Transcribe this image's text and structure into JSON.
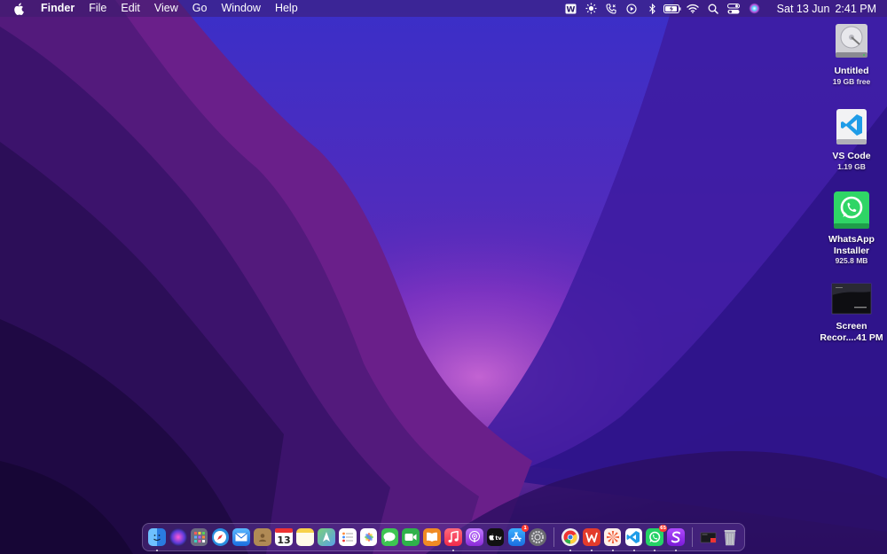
{
  "menubar": {
    "app_name": "Finder",
    "items": [
      "File",
      "Edit",
      "View",
      "Go",
      "Window",
      "Help"
    ],
    "status_icons": [
      "word-icon",
      "sun-icon",
      "phone-icon",
      "play-icon",
      "bluetooth-icon",
      "battery-icon",
      "wifi-icon",
      "search-icon",
      "control-center-icon",
      "siri-icon"
    ],
    "date": "Sat 13 Jun",
    "time": "2:41 PM"
  },
  "desktop": {
    "items": [
      {
        "name": "Untitled",
        "sub": "19 GB free",
        "icon": "hard-drive-icon"
      },
      {
        "name": "VS Code",
        "sub": "1.19 GB",
        "icon": "vscode-icon"
      },
      {
        "name": "WhatsApp",
        "name2": "Installer",
        "sub": "925.8 MB",
        "icon": "whatsapp-icon"
      },
      {
        "name": "Screen",
        "name2": "Recor....41 PM",
        "icon": "screen-recording-icon"
      }
    ]
  },
  "dock": {
    "apps": [
      {
        "name": "finder",
        "color": "#3a8ee6",
        "running": true
      },
      {
        "name": "siri",
        "color": "#4b2fa3"
      },
      {
        "name": "launchpad",
        "color": "#8a8aa0"
      },
      {
        "name": "safari",
        "color": "#2a8fe0"
      },
      {
        "name": "mail",
        "color": "#2a7fe8"
      },
      {
        "name": "contacts",
        "color": "#b08a55"
      },
      {
        "name": "calendar",
        "color": "#ffffff",
        "glyph": "13",
        "glyph_color": "#d33"
      },
      {
        "name": "notes",
        "color": "#f7d24a"
      },
      {
        "name": "maps",
        "color": "#58b85a"
      },
      {
        "name": "reminders",
        "color": "#ffffff"
      },
      {
        "name": "photos",
        "color": "#f0a040"
      },
      {
        "name": "messages",
        "color": "#3ec452"
      },
      {
        "name": "facetime",
        "color": "#2fb24a"
      },
      {
        "name": "books",
        "color": "#f08a24"
      },
      {
        "name": "music",
        "color": "#fa3e5a",
        "running": true
      },
      {
        "name": "podcasts",
        "color": "#a052d8"
      },
      {
        "name": "tv",
        "color": "#111111",
        "glyph": "tv"
      },
      {
        "name": "app-store",
        "color": "#1e90ff",
        "badge": "1"
      },
      {
        "name": "system-preferences",
        "color": "#8a8a8a"
      },
      {
        "name": "chrome",
        "color": "#e9e9e9",
        "running": true
      },
      {
        "name": "wps-office",
        "color": "#e33b2c",
        "glyph": "W",
        "running": true
      },
      {
        "name": "pinwheel",
        "color": "#f0603a",
        "running": true
      },
      {
        "name": "vs-code",
        "color": "#ffffff",
        "running": true
      },
      {
        "name": "whatsapp",
        "color": "#25d366",
        "badge": "65",
        "running": true
      },
      {
        "name": "setapp",
        "color": "#8e2fd6",
        "glyph": "S",
        "running": true
      },
      {
        "name": "screen-recording",
        "color": "#2a2a2a"
      },
      {
        "name": "trash",
        "color": "#9a9aa6"
      }
    ]
  }
}
